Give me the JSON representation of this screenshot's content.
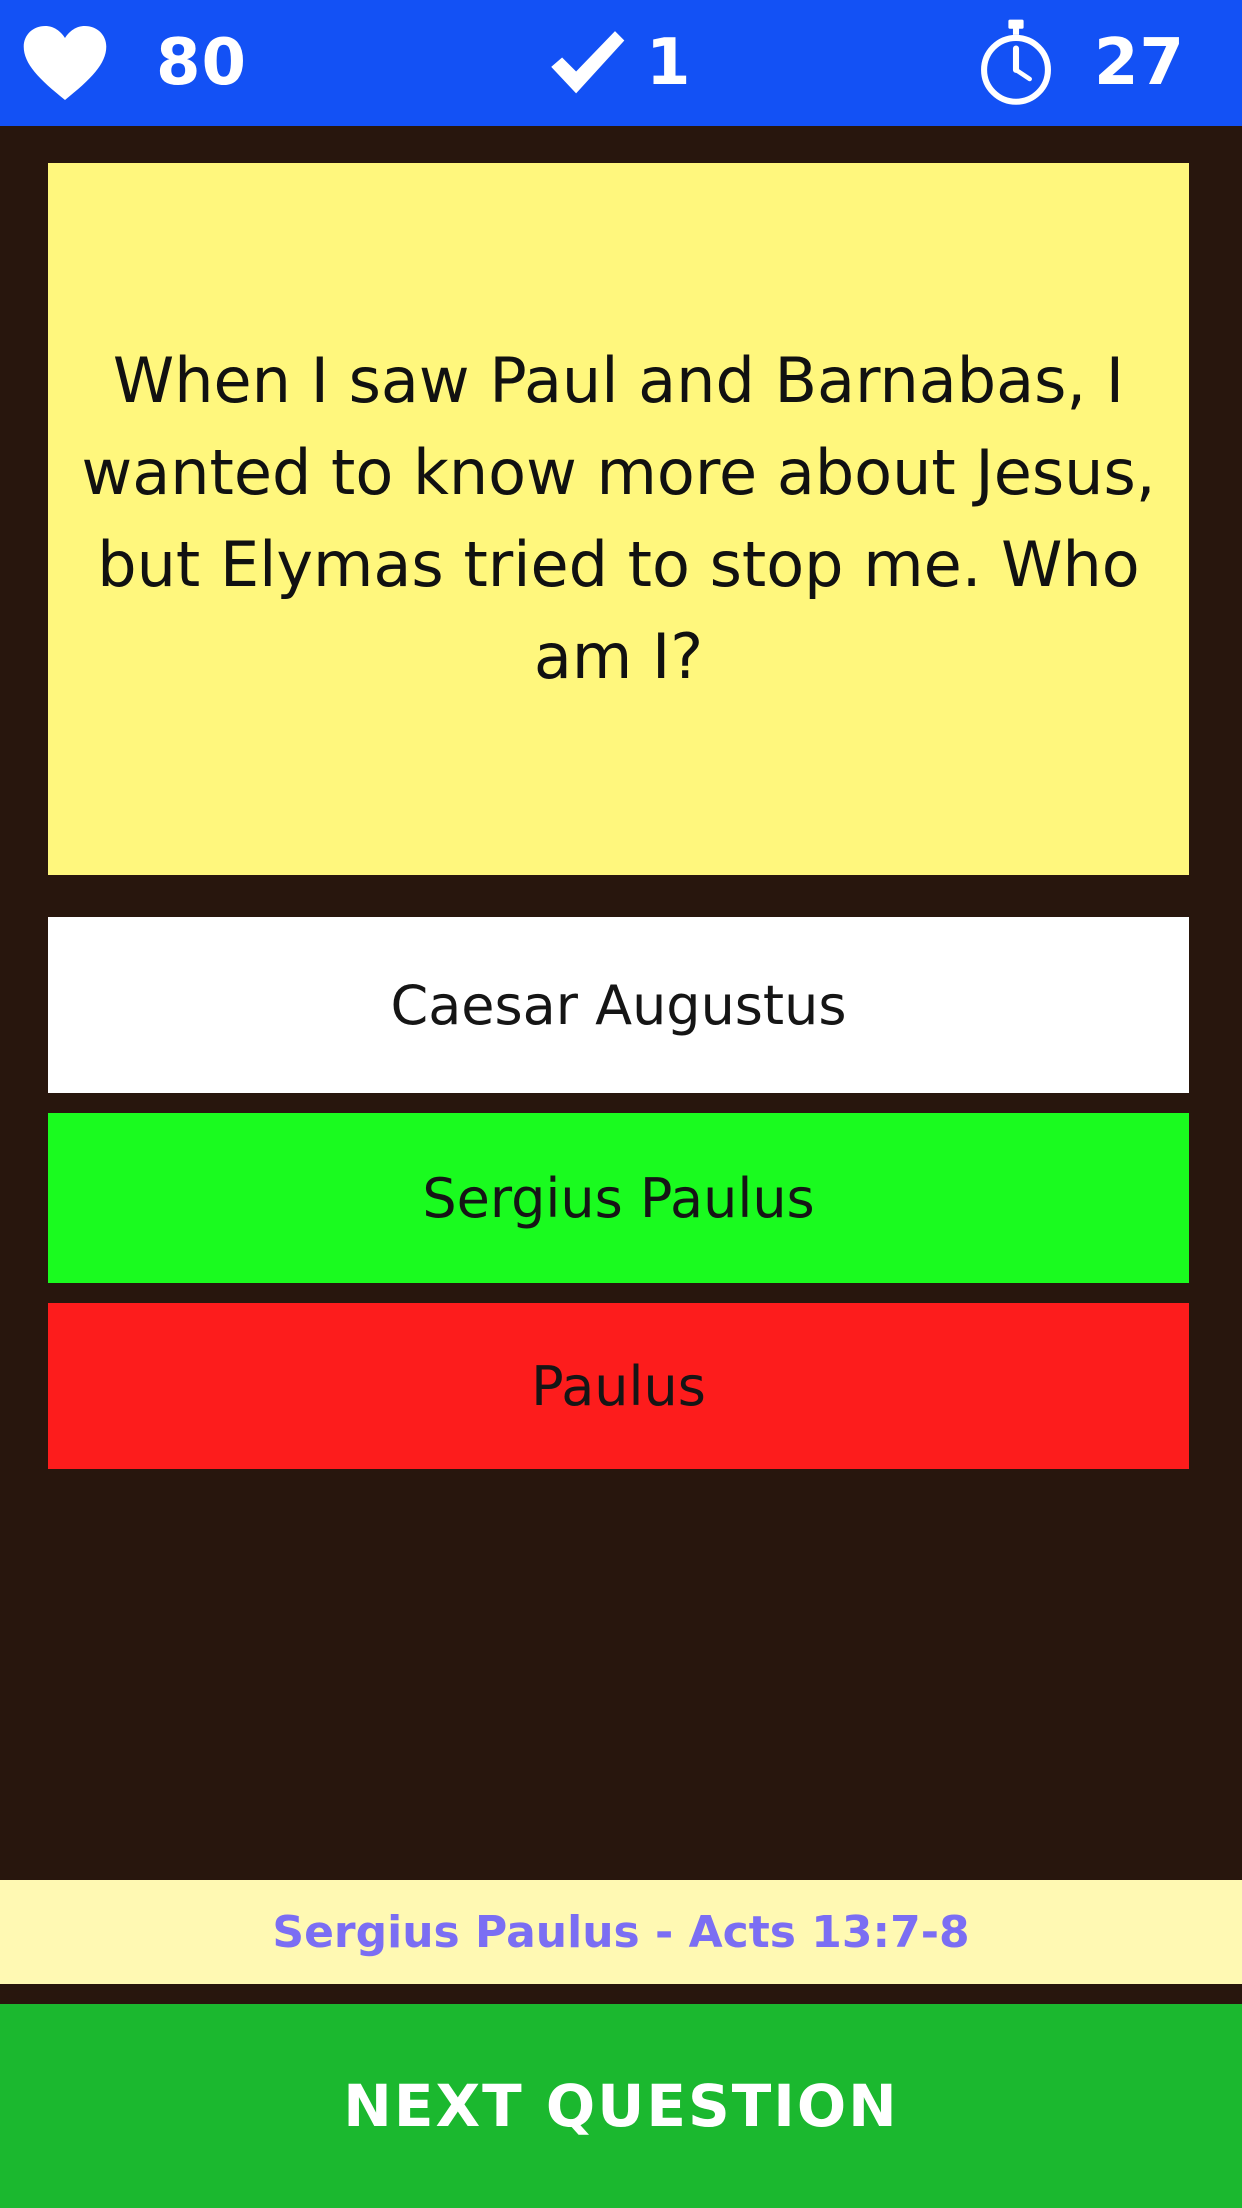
{
  "status_bar": {
    "lives": {
      "icon": "heart-icon",
      "value": "80"
    },
    "correct": {
      "icon": "checkmark-icon",
      "value": "1"
    },
    "timer": {
      "icon": "stopwatch-icon",
      "value": "27"
    }
  },
  "question": {
    "text": "When I saw Paul and Barnabas, I wanted to know more about Jesus, but Elymas tried to stop me. Who am I?"
  },
  "answers": [
    {
      "label": "Caesar Augustus",
      "state": "neutral",
      "color": "#ffffff"
    },
    {
      "label": "Sergius Paulus",
      "state": "correct",
      "color": "#1afb1f"
    },
    {
      "label": "Paulus",
      "state": "wrong",
      "color": "#fd1c1c"
    }
  ],
  "reference": {
    "text": "Sergius Paulus - Acts 13:7-8"
  },
  "next_button": {
    "label": "NEXT QUESTION"
  },
  "colors": {
    "topbar": "#1351f5",
    "background": "#28160d",
    "question_card": "#fff77d",
    "reference_strip": "#fff9b3",
    "reference_text": "#7b6ef3",
    "next_button": "#1bb82f"
  }
}
